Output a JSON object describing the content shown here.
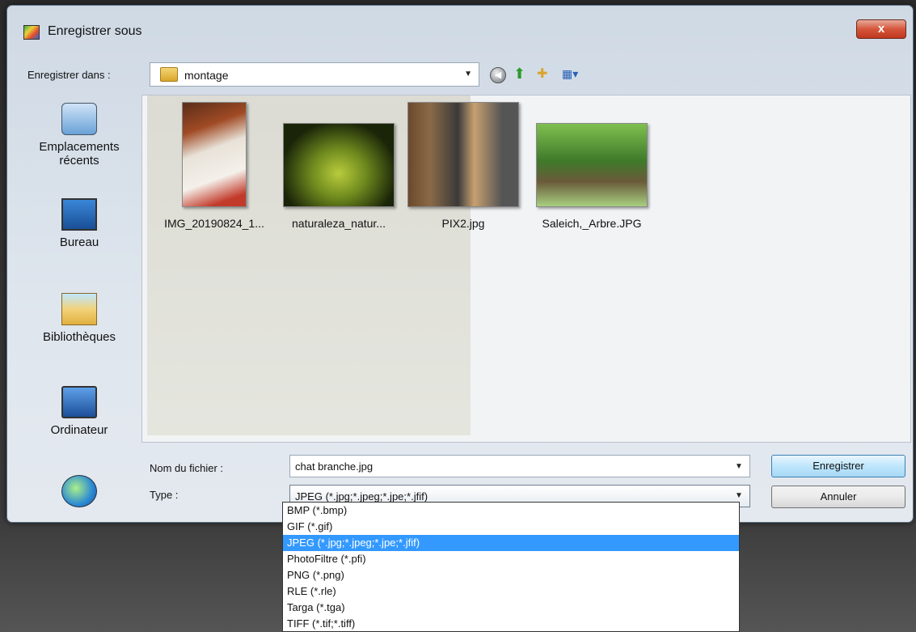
{
  "window": {
    "title": "Enregistrer sous",
    "close_label": "x"
  },
  "save_in": {
    "label": "Enregistrer dans :",
    "value": "montage"
  },
  "places": [
    {
      "label": "Emplacements récents"
    },
    {
      "label": "Bureau"
    },
    {
      "label": "Bibliothèques"
    },
    {
      "label": "Ordinateur"
    }
  ],
  "files": [
    {
      "name": "IMG_20190824_1..."
    },
    {
      "name": "naturaleza_natur..."
    },
    {
      "name": "PIX2.jpg"
    },
    {
      "name": "Saleich,_Arbre.JPG"
    }
  ],
  "form": {
    "filename_label": "Nom du fichier :",
    "filename_value": "chat branche.jpg",
    "type_label": "Type :",
    "type_value": "JPEG (*.jpg;*.jpeg;*.jpe;*.jfif)"
  },
  "buttons": {
    "save": "Enregistrer",
    "cancel": "Annuler"
  },
  "type_options": [
    "BMP (*.bmp)",
    "GIF (*.gif)",
    "JPEG (*.jpg;*.jpeg;*.jpe;*.jfif)",
    "PhotoFiltre (*.pfi)",
    "PNG (*.png)",
    "RLE (*.rle)",
    "Targa (*.tga)",
    "TIFF (*.tif;*.tiff)"
  ],
  "selected_option": "JPEG (*.jpg;*.jpeg;*.jpe;*.jfif)",
  "colors": {
    "selection": "#3399ff",
    "close_button": "#c1371e"
  }
}
